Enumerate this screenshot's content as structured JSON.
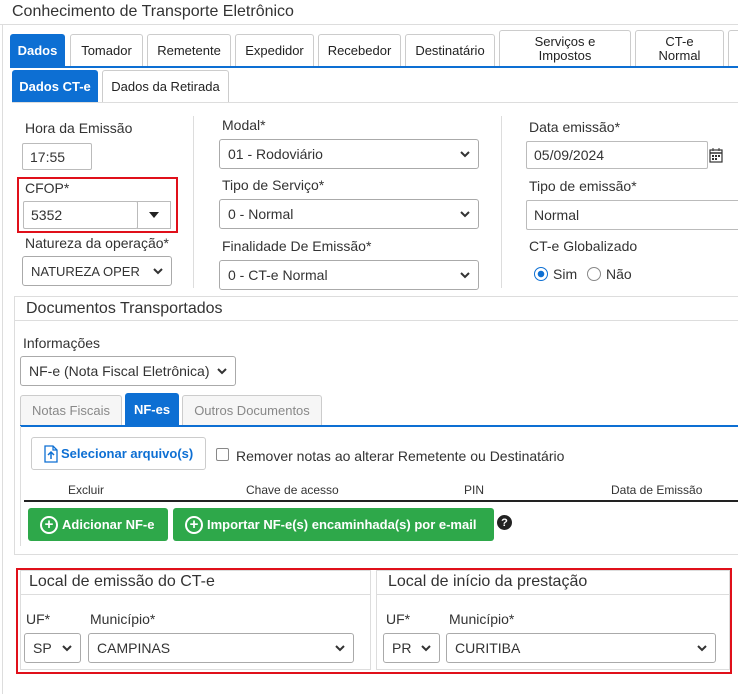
{
  "window": {
    "title": "Conhecimento de Transporte Eletrônico"
  },
  "main_tabs": [
    {
      "label": "Dados",
      "active": true
    },
    {
      "label": "Tomador"
    },
    {
      "label": "Remetente"
    },
    {
      "label": "Expedidor"
    },
    {
      "label": "Recebedor"
    },
    {
      "label": "Destinatário"
    },
    {
      "label": "Serviços e Impostos"
    },
    {
      "label": "CT-e Normal"
    }
  ],
  "sub_tabs": [
    {
      "label": "Dados CT-e",
      "active": true
    },
    {
      "label": "Dados da Retirada"
    }
  ],
  "form": {
    "hora_label": "Hora da Emissão",
    "hora_value": "17:55",
    "cfop_label": "CFOP*",
    "cfop_value": "5352",
    "natureza_label": "Natureza da operação*",
    "natureza_value": "NATUREZA OPER",
    "modal_label": "Modal*",
    "modal_value": "01 - Rodoviário",
    "tipo_servico_label": "Tipo de Serviço*",
    "tipo_servico_value": "0 - Normal",
    "finalidade_label": "Finalidade De Emissão*",
    "finalidade_value": "0 - CT-e Normal",
    "data_emissao_label": "Data emissão*",
    "data_emissao_value": "05/09/2024",
    "tipo_emissao_label": "Tipo de emissão*",
    "tipo_emissao_value": "Normal",
    "globalizado_label": "CT-e Globalizado",
    "globalizado_sim": "Sim",
    "globalizado_nao": "Não",
    "globalizado_selected": "Sim"
  },
  "documentos": {
    "title": "Documentos Transportados",
    "info_label": "Informações",
    "info_value": "NF-e (Nota Fiscal Eletrônica)",
    "tabs": [
      {
        "label": "Notas Fiscais"
      },
      {
        "label": "NF-es",
        "active": true
      },
      {
        "label": "Outros Documentos"
      }
    ],
    "select_file_label": "Selecionar arquivo(s)",
    "remover_label": "Remover notas ao alterar Remetente ou Destinatário",
    "columns": [
      "Excluir",
      "Chave de acesso",
      "PIN",
      "Data de Emissão"
    ],
    "add_button": "Adicionar NF-e",
    "import_button": "Importar NF-e(s) encaminhada(s) por e-mail"
  },
  "local_emissao": {
    "title": "Local de emissão do CT-e",
    "uf_label": "UF*",
    "uf_value": "SP",
    "municipio_label": "Município*",
    "municipio_value": "CAMPINAS"
  },
  "local_inicio": {
    "title": "Local de início da prestação",
    "uf_label": "UF*",
    "uf_value": "PR",
    "municipio_label": "Município*",
    "municipio_value": "CURITIBA"
  },
  "colors": {
    "primary": "#0d6fd3",
    "success": "#2ea84a",
    "highlight": "#e0101a"
  }
}
